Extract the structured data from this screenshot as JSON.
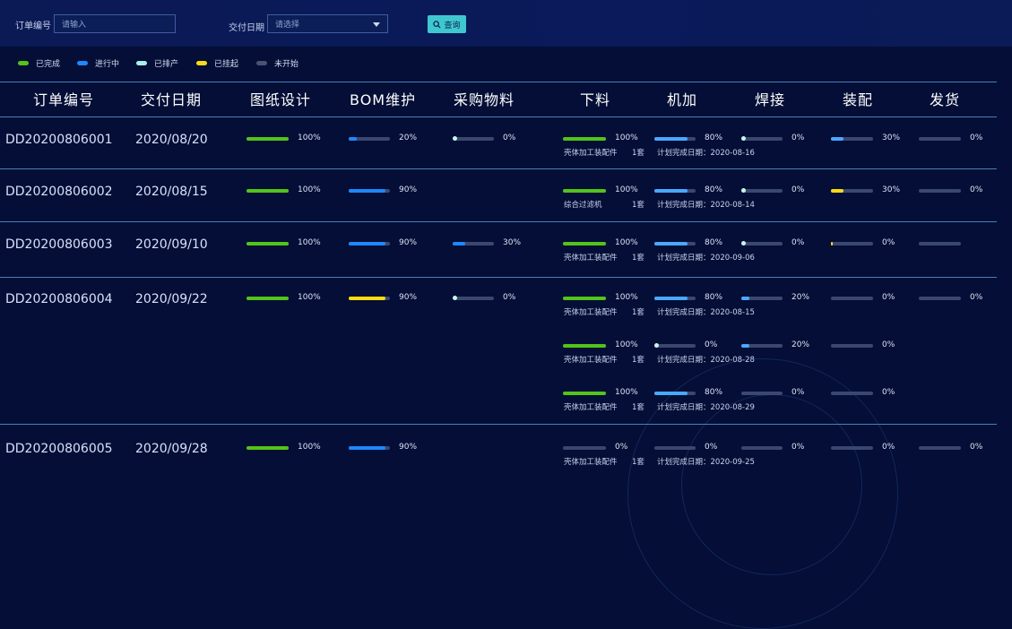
{
  "colors": {
    "green": "#52c41a",
    "blue": "#1e88ff",
    "lightblue": "#4aa8ff",
    "cyan": "#a8f0ea",
    "yellow": "#fadb14",
    "gray": "#3a4870"
  },
  "filter": {
    "order_label": "订单编号",
    "order_placeholder": "请输入",
    "date_label": "交付日期",
    "date_placeholder": "请选择",
    "query_label": "查询"
  },
  "legend": [
    {
      "label": "已完成",
      "color": "#52c41a"
    },
    {
      "label": "进行中",
      "color": "#1e88ff"
    },
    {
      "label": "已排产",
      "color": "#a8f0ea"
    },
    {
      "label": "已挂起",
      "color": "#fadb14"
    },
    {
      "label": "未开始",
      "color": "#4a5270"
    }
  ],
  "headers": [
    "订单编号",
    "交付日期",
    "图纸设计",
    "BOM维护",
    "采购物料",
    "下料",
    "机加",
    "焊接",
    "装配",
    "发货"
  ],
  "orders": [
    {
      "id": "DD20200806001",
      "date": "2020/08/20",
      "drawing": {
        "pct": "100%",
        "val": 100,
        "color": "green"
      },
      "bom": {
        "pct": "20%",
        "val": 20,
        "color": "blue"
      },
      "purchase": {
        "pct": "0%",
        "val": 0,
        "color": "cyan"
      },
      "parts": [
        {
          "cut": {
            "pct": "100%",
            "val": 100,
            "color": "green"
          },
          "machining": {
            "pct": "80%",
            "val": 80,
            "color": "lightblue"
          },
          "welding": {
            "pct": "0%",
            "val": 0,
            "color": "cyan"
          },
          "assembly": {
            "pct": "30%",
            "val": 30,
            "color": "lightblue"
          },
          "shipping": {
            "pct": "0%",
            "val": 0,
            "color": "gray"
          },
          "name": "壳体加工装配件",
          "qty": "1套",
          "plan": "计划完成日期：2020-08-16"
        }
      ]
    },
    {
      "id": "DD20200806002",
      "date": "2020/08/15",
      "drawing": {
        "pct": "100%",
        "val": 100,
        "color": "green"
      },
      "bom": {
        "pct": "90%",
        "val": 90,
        "color": "blue"
      },
      "purchase": null,
      "parts": [
        {
          "cut": {
            "pct": "100%",
            "val": 100,
            "color": "green"
          },
          "machining": {
            "pct": "80%",
            "val": 80,
            "color": "lightblue"
          },
          "welding": {
            "pct": "0%",
            "val": 0,
            "color": "cyan"
          },
          "assembly": {
            "pct": "30%",
            "val": 30,
            "color": "yellow"
          },
          "shipping": {
            "pct": "0%",
            "val": 0,
            "color": "gray"
          },
          "name": "综合过滤机",
          "qty": "1套",
          "plan": "计划完成日期：2020-08-14"
        }
      ]
    },
    {
      "id": "DD20200806003",
      "date": "2020/09/10",
      "drawing": {
        "pct": "100%",
        "val": 100,
        "color": "green"
      },
      "bom": {
        "pct": "90%",
        "val": 90,
        "color": "blue"
      },
      "purchase": {
        "pct": "30%",
        "val": 30,
        "color": "blue"
      },
      "parts": [
        {
          "cut": {
            "pct": "100%",
            "val": 100,
            "color": "green"
          },
          "machining": {
            "pct": "80%",
            "val": 80,
            "color": "lightblue"
          },
          "welding": {
            "pct": "0%",
            "val": 0,
            "color": "cyan"
          },
          "assembly": {
            "pct": "0%",
            "val": 5,
            "color": "yellow"
          },
          "shipping": {
            "pct": "",
            "val": 0,
            "color": "gray"
          },
          "name": "壳体加工装配件",
          "qty": "1套",
          "plan": "计划完成日期：2020-09-06"
        }
      ]
    },
    {
      "id": "DD20200806004",
      "date": "2020/09/22",
      "drawing": {
        "pct": "100%",
        "val": 100,
        "color": "green"
      },
      "bom": {
        "pct": "90%",
        "val": 90,
        "color": "yellow"
      },
      "purchase": {
        "pct": "0%",
        "val": 0,
        "color": "cyan"
      },
      "parts": [
        {
          "cut": {
            "pct": "100%",
            "val": 100,
            "color": "green"
          },
          "machining": {
            "pct": "80%",
            "val": 80,
            "color": "lightblue"
          },
          "welding": {
            "pct": "20%",
            "val": 20,
            "color": "lightblue"
          },
          "assembly": {
            "pct": "0%",
            "val": 0,
            "color": "gray"
          },
          "shipping": {
            "pct": "0%",
            "val": 0,
            "color": "gray"
          },
          "name": "壳体加工装配件",
          "qty": "1套",
          "plan": "计划完成日期：2020-08-15"
        },
        {
          "cut": {
            "pct": "100%",
            "val": 100,
            "color": "green"
          },
          "machining": {
            "pct": "0%",
            "val": 0,
            "color": "cyan"
          },
          "welding": {
            "pct": "20%",
            "val": 20,
            "color": "lightblue"
          },
          "assembly": {
            "pct": "0%",
            "val": 0,
            "color": "gray"
          },
          "shipping": null,
          "name": "壳体加工装配件",
          "qty": "1套",
          "plan": "计划完成日期：2020-08-28"
        },
        {
          "cut": {
            "pct": "100%",
            "val": 100,
            "color": "green"
          },
          "machining": {
            "pct": "80%",
            "val": 80,
            "color": "lightblue"
          },
          "welding": {
            "pct": "0%",
            "val": 0,
            "color": "gray"
          },
          "assembly": {
            "pct": "0%",
            "val": 0,
            "color": "gray"
          },
          "shipping": null,
          "name": "壳体加工装配件",
          "qty": "1套",
          "plan": "计划完成日期：2020-08-29"
        }
      ]
    },
    {
      "id": "DD20200806005",
      "date": "2020/09/28",
      "drawing": {
        "pct": "100%",
        "val": 100,
        "color": "green"
      },
      "bom": {
        "pct": "90%",
        "val": 90,
        "color": "blue"
      },
      "purchase": null,
      "parts": [
        {
          "cut": {
            "pct": "0%",
            "val": 0,
            "color": "gray"
          },
          "machining": {
            "pct": "0%",
            "val": 0,
            "color": "gray"
          },
          "welding": {
            "pct": "0%",
            "val": 0,
            "color": "gray"
          },
          "assembly": {
            "pct": "0%",
            "val": 0,
            "color": "gray"
          },
          "shipping": {
            "pct": "0%",
            "val": 0,
            "color": "gray"
          },
          "name": "壳体加工装配件",
          "qty": "1套",
          "plan": "计划完成日期：2020-09-25"
        }
      ]
    }
  ]
}
